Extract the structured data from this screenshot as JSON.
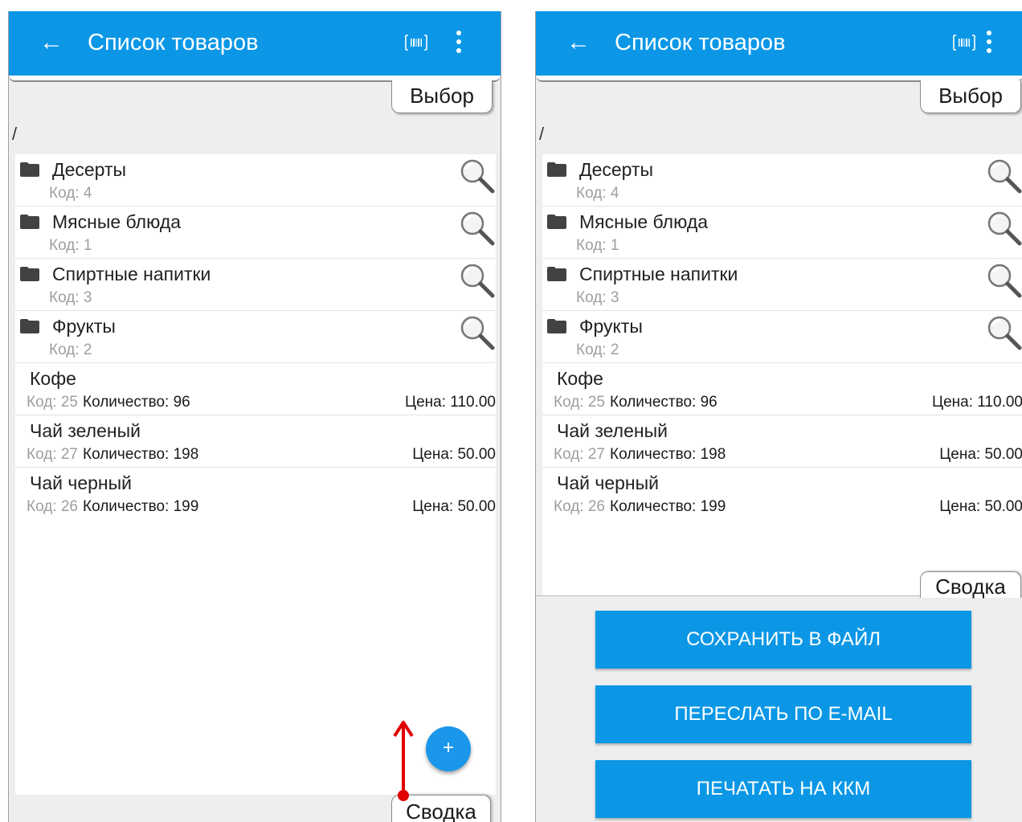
{
  "screens": {
    "left": {
      "appbar": {
        "back_icon": "←",
        "title": "Список товаров",
        "barcode_icon": "barcode-icon",
        "menu_icon": "more-vert-icon"
      },
      "select_tab": "Выбор",
      "path": "/",
      "groups": [
        {
          "name": "Десерты",
          "code": "Код: 4"
        },
        {
          "name": "Мясные блюда",
          "code": "Код: 1"
        },
        {
          "name": "Спиртные напитки",
          "code": "Код: 3"
        },
        {
          "name": "Фрукты",
          "code": "Код: 2"
        }
      ],
      "products": [
        {
          "name": "Кофе",
          "code": "Код: 25",
          "qty": "Количество: 96",
          "price": "Цена: 110.00"
        },
        {
          "name": "Чай зеленый",
          "code": "Код: 27",
          "qty": "Количество: 198",
          "price": "Цена: 50.00"
        },
        {
          "name": "Чай черный",
          "code": "Код: 26",
          "qty": "Количество: 199",
          "price": "Цена: 50.00"
        }
      ],
      "fab": "+",
      "summary_tab": "Сводка"
    },
    "right": {
      "appbar": {
        "back_icon": "←",
        "title": "Список товаров",
        "barcode_icon": "barcode-icon",
        "menu_icon": "more-vert-icon"
      },
      "select_tab": "Выбор",
      "path": "/",
      "groups": [
        {
          "name": "Десерты",
          "code": "Код: 4"
        },
        {
          "name": "Мясные блюда",
          "code": "Код: 1"
        },
        {
          "name": "Спиртные напитки",
          "code": "Код: 3"
        },
        {
          "name": "Фрукты",
          "code": "Код: 2"
        }
      ],
      "products": [
        {
          "name": "Кофе",
          "code": "Код: 25",
          "qty": "Количество: 96",
          "price": "Цена: 110.00"
        },
        {
          "name": "Чай зеленый",
          "code": "Код: 27",
          "qty": "Количество: 198",
          "price": "Цена: 50.00"
        },
        {
          "name": "Чай черный",
          "code": "Код: 26",
          "qty": "Количество: 199",
          "price": "Цена: 50.00"
        }
      ],
      "summary_tab": "Сводка",
      "buttons": [
        "СОХРАНИТЬ В ФАЙЛ",
        "ПЕРЕСЛАТЬ ПО E-MAIL",
        "ПЕЧАТАТЬ НА ККМ"
      ]
    }
  },
  "colors": {
    "appbar": "#0b97e6",
    "button": "#0b97e6",
    "annotation_arrow": "#e00000"
  },
  "annotation": {
    "icon": "swipe-up-arrow-icon"
  }
}
